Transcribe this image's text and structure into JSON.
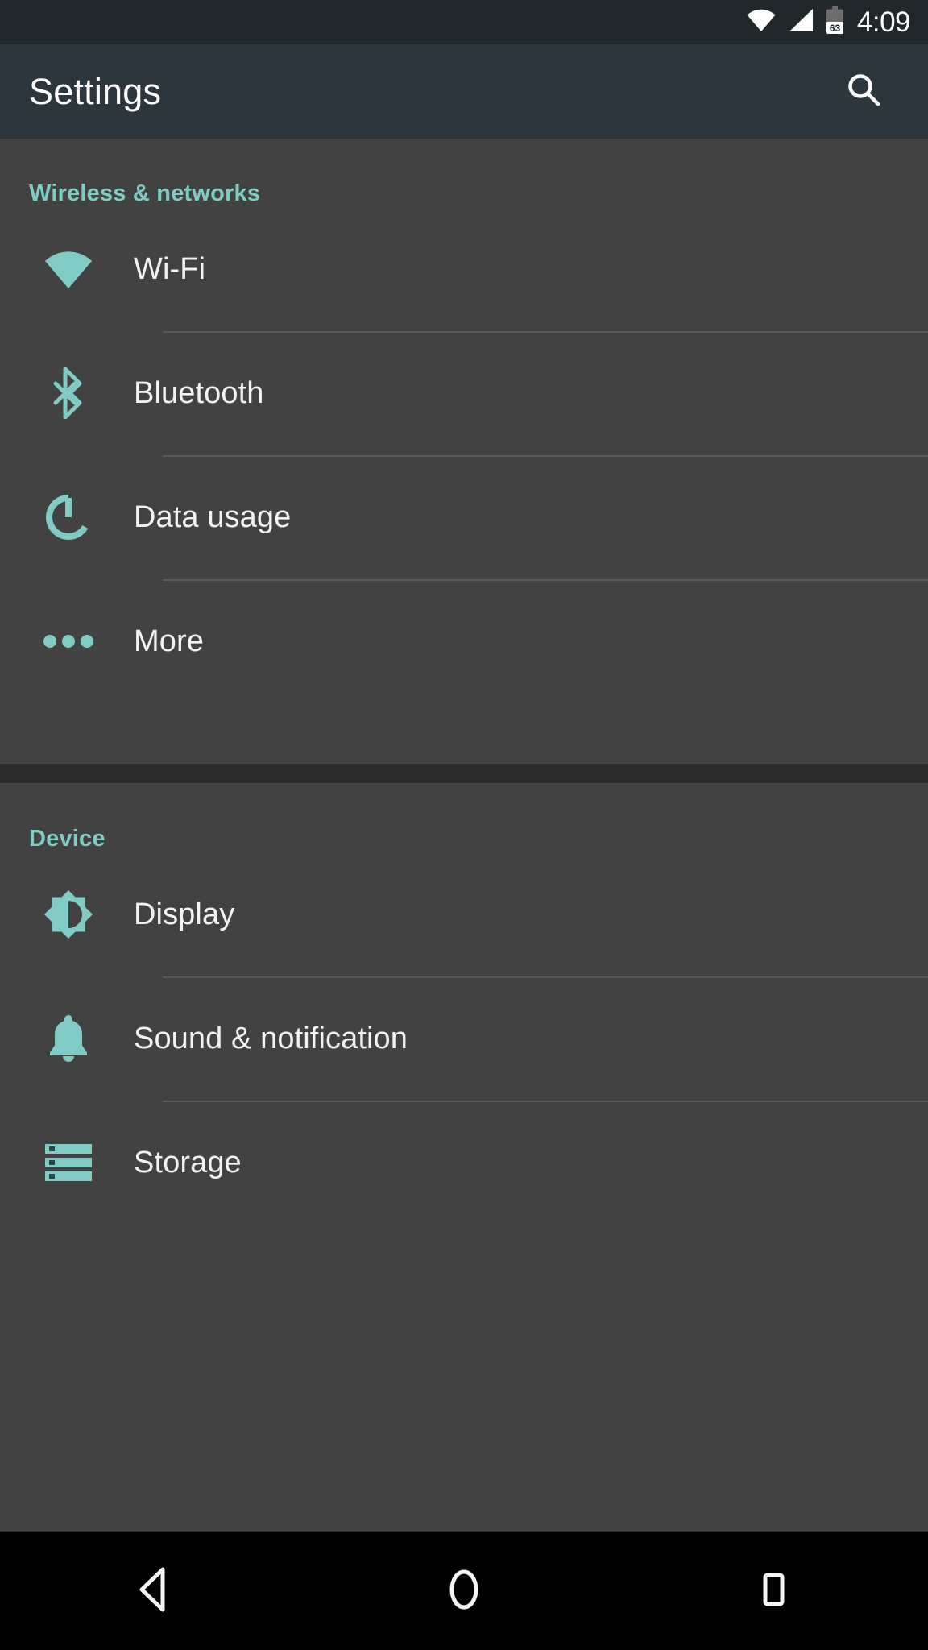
{
  "statusbar": {
    "clock": "4:09",
    "battery_level": "63",
    "icons": [
      "wifi-status-icon",
      "cell-signal-icon",
      "battery-icon"
    ]
  },
  "appbar": {
    "title": "Settings",
    "search_icon": "search-icon"
  },
  "sections": [
    {
      "header": "Wireless & networks",
      "items": [
        {
          "label": "Wi-Fi",
          "icon": "wifi-icon"
        },
        {
          "label": "Bluetooth",
          "icon": "bluetooth-icon"
        },
        {
          "label": "Data usage",
          "icon": "data-usage-icon"
        },
        {
          "label": "More",
          "icon": "more-dots-icon"
        }
      ]
    },
    {
      "header": "Device",
      "items": [
        {
          "label": "Display",
          "icon": "brightness-icon"
        },
        {
          "label": "Sound & notification",
          "icon": "bell-icon"
        },
        {
          "label": "Storage",
          "icon": "storage-icon"
        }
      ]
    }
  ],
  "navbar": {
    "back": "back-icon",
    "home": "home-icon",
    "recents": "recents-icon"
  },
  "colors": {
    "accent": "#80cbc4",
    "appbar": "#2b373d",
    "statusbar": "#20282c",
    "background": "#424242",
    "divider": "#5a5a5a",
    "label": "#f2f2f2",
    "navbar": "#000000"
  }
}
